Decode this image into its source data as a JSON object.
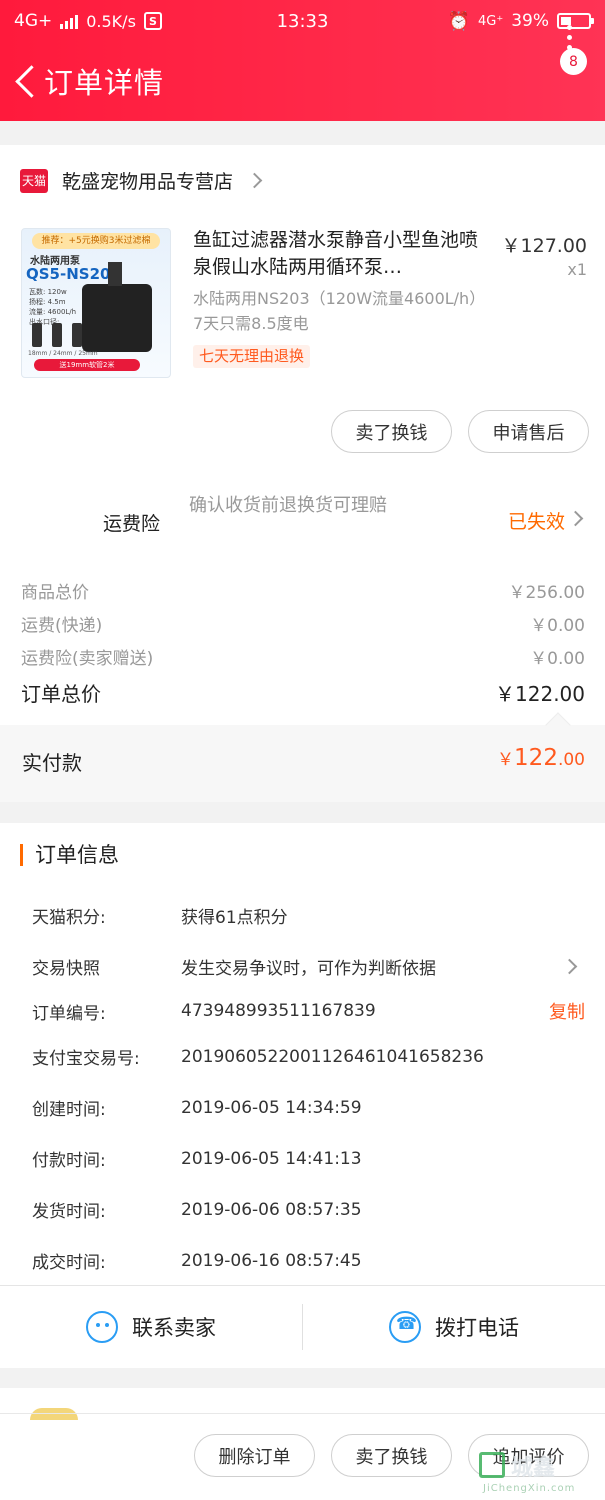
{
  "status_bar": {
    "network": "4G+",
    "speed": "0.5K/s",
    "app_icon": "S",
    "time": "13:33",
    "network_right": "4G⁺",
    "battery_text": "39%",
    "battery_level": 0.39
  },
  "nav": {
    "title": "订单详情",
    "badge": "8"
  },
  "store": {
    "platform_tag": "天猫",
    "name": "乾盛宠物用品专营店"
  },
  "product": {
    "thumb": {
      "promo": "推荐：+5元换购3米过滤棉",
      "subtitle": "水陆两用泵",
      "model": "QS5-NS203",
      "specs": "瓦数: 120w\n扬程: 4.5m\n流量: 4600L/h\n出水口径:",
      "sizes": "18mm / 24mm / 25mm",
      "bottom": "送19mm软管2米"
    },
    "title": "鱼缸过滤器潜水泵静音小型鱼池喷泉假山水陆两用循环泵…",
    "spec": "水陆两用NS203（120W流量4600L/h）7天只需8.5度电",
    "tag": "七天无理由退换",
    "price": "￥127.00",
    "qty": "x1"
  },
  "actions": {
    "sell": "卖了换钱",
    "after_sales": "申请售后"
  },
  "insurance": {
    "label": "运费险",
    "desc": "确认收货前退换货可理赔",
    "status": "已失效"
  },
  "fees": [
    {
      "label": "商品总价",
      "value": "￥256.00"
    },
    {
      "label": "运费(快递)",
      "value": "￥0.00"
    },
    {
      "label": "运费险(卖家赠送)",
      "value": "￥0.00"
    }
  ],
  "total": {
    "label": "订单总价",
    "value": "￥122.00"
  },
  "paid": {
    "label": "实付款",
    "currency": "￥",
    "int": "122",
    "dec": ".00"
  },
  "order_info": {
    "title": "订单信息",
    "rows": [
      {
        "k": "天猫积分:",
        "v": "获得61点积分"
      },
      {
        "k": "交易快照",
        "v": "发生交易争议时，可作为判断依据"
      },
      {
        "k": "订单编号:",
        "v": "473948993511167839",
        "action": "复制"
      },
      {
        "k": "支付宝交易号:",
        "v": "2019060522001126461041658236"
      },
      {
        "k": "创建时间:",
        "v": "2019-06-05 14:34:59"
      },
      {
        "k": "付款时间:",
        "v": "2019-06-05 14:41:13"
      },
      {
        "k": "发货时间:",
        "v": "2019-06-06 08:57:35"
      },
      {
        "k": "成交时间:",
        "v": "2019-06-16 08:57:45"
      }
    ],
    "contact_seller": "联系卖家",
    "call_phone": "拨打电话"
  },
  "bottom_bar": {
    "delete": "删除订单",
    "sell": "卖了换钱",
    "review": "追加评价"
  },
  "watermark": {
    "text": "城鑫",
    "sub": "JiChengXin.com"
  },
  "colors": {
    "brand_red": "#ff1a3c",
    "accent_orange": "#ff5a1f",
    "link_blue": "#2a9df4"
  }
}
